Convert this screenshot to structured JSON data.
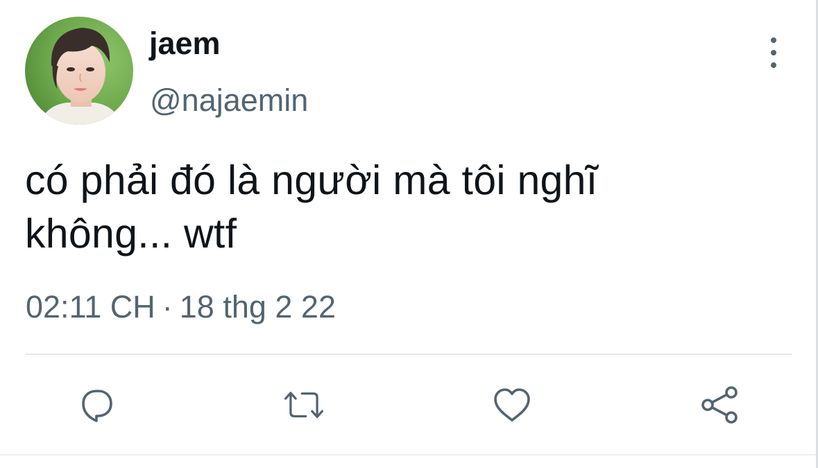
{
  "tweet": {
    "author": {
      "display_name": "jaem",
      "handle": "@najaemin",
      "avatar_icon": "profile-photo"
    },
    "text_lines": [
      "có phải đó là người mà tôi nghĩ",
      "không... wtf"
    ],
    "time": "02:11 CH",
    "separator": "·",
    "date": "18 thg 2 22",
    "more_icon": "vertical-ellipsis-icon"
  },
  "actions": [
    {
      "name": "reply",
      "icon": "speech-bubble-icon"
    },
    {
      "name": "retweet",
      "icon": "retweet-arrows-icon"
    },
    {
      "name": "like",
      "icon": "heart-icon"
    },
    {
      "name": "share",
      "icon": "share-nodes-icon"
    }
  ],
  "colors": {
    "text_primary": "#0f1419",
    "text_secondary": "#536471",
    "divider": "#e6e9eb",
    "background": "#ffffff"
  }
}
